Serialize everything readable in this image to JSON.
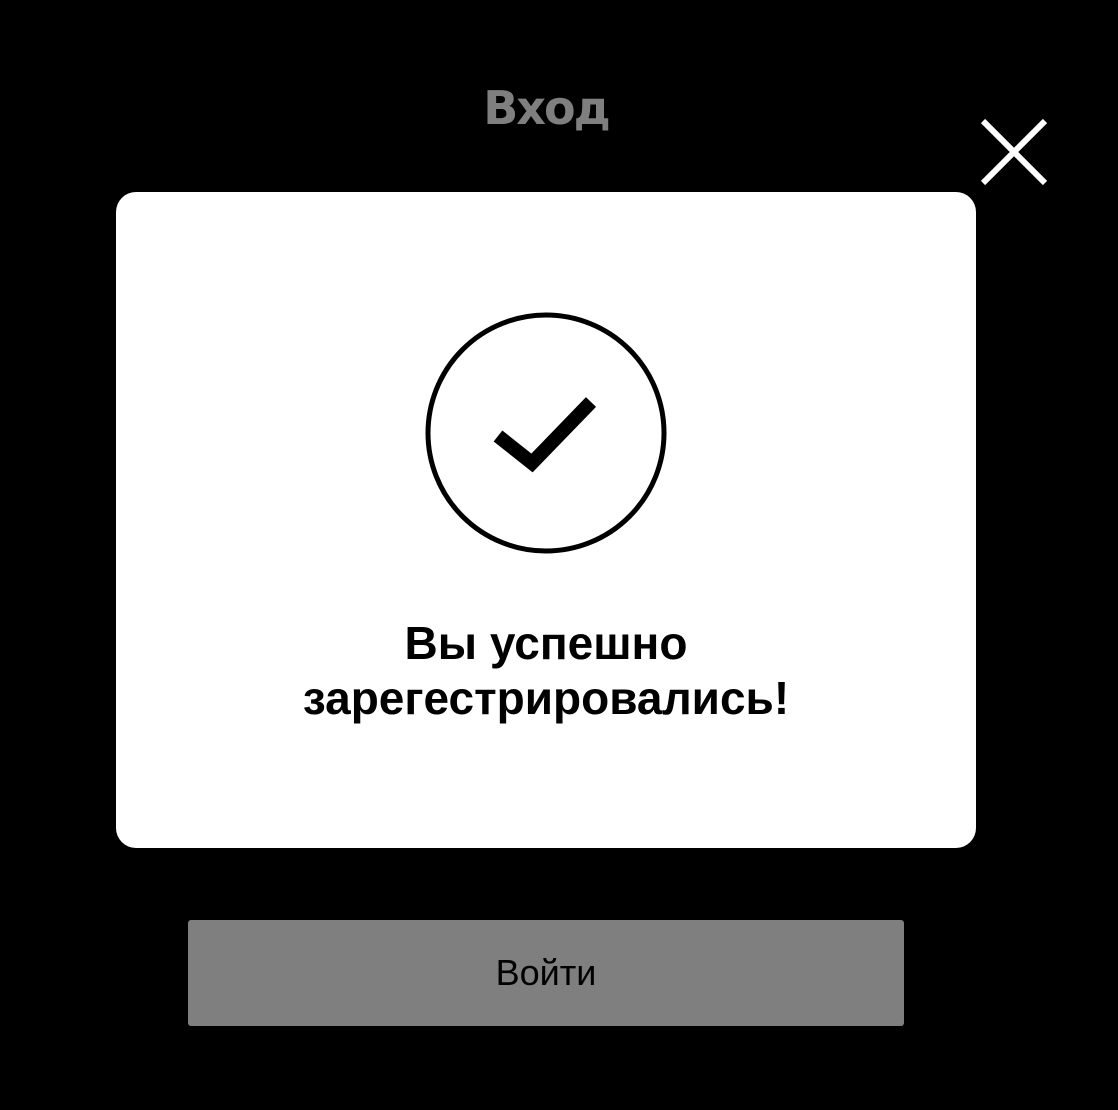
{
  "header": {
    "title": "Вход"
  },
  "close": {
    "icon": "close-icon",
    "color": "#ffffff"
  },
  "modal": {
    "icon": "checkmark-circle-icon",
    "message_line1": "Вы успешно",
    "message_line2": "зарегестрировались!",
    "background": "#ffffff"
  },
  "form": {
    "login_label": "Войти",
    "button_color": "#7f7f7f"
  },
  "colors": {
    "background": "#000000",
    "title": "#7f7f7f"
  }
}
